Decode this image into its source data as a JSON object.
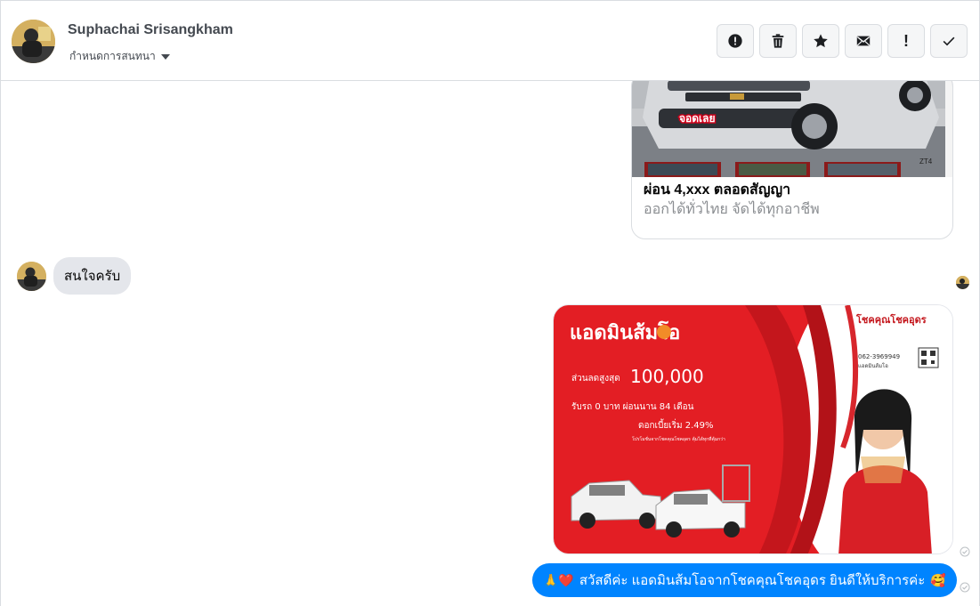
{
  "header": {
    "contact_name": "Suphachai Srisangkham",
    "conversation_setting_label": "กำหนดการสนทนา",
    "toolbar": [
      {
        "icon": "alert-circle-icon",
        "action": "report"
      },
      {
        "icon": "trash-icon",
        "action": "delete"
      },
      {
        "icon": "star-icon",
        "action": "star"
      },
      {
        "icon": "envelope-icon",
        "action": "mark-unread"
      },
      {
        "icon": "exclamation-icon",
        "action": "spam"
      },
      {
        "icon": "check-icon",
        "action": "done"
      }
    ]
  },
  "thread": {
    "link_card": {
      "image_badge_text": "จอดเลย",
      "image_corner_text": "ZT4",
      "title": "ผ่อน 4,xxx ตลอดสัญญา",
      "subtitle": "ออกได้ทั่วไทย จัดได้ทุกอาชีพ"
    },
    "incoming_message": "สนใจครับ",
    "promo_image": {
      "brand": "แอดมินส้มโอ",
      "company": "โชคคุณโชคอุดร",
      "discount_label": "ส่วนลดสูงสุด",
      "discount_value": "100,000",
      "down_line": "รับรถ 0 บาท ผ่อนนาน 84 เดือน",
      "interest_line": "ดอกเบี้ยเริ่ม 2.49%",
      "footnote": "โปรโมชั่นจากโชคคุณโชคอุดร คุ้มได้ทุกที่คุ้มกว่า",
      "phone": "062-3969949",
      "admin_tag": "แอดมินส้มโอ"
    },
    "outgoing_message": {
      "prefix_emoji": "🙏❤️",
      "text": "สวัสดีค่ะ แอดมินส้มโอจากโชคคุณโชคอุดร ยินดีให้บริการค่ะ",
      "suffix_emoji": "🥰"
    }
  },
  "colors": {
    "accent": "#0084ff",
    "incoming_bubble": "#e4e6eb",
    "promo_red": "#e31e24"
  }
}
